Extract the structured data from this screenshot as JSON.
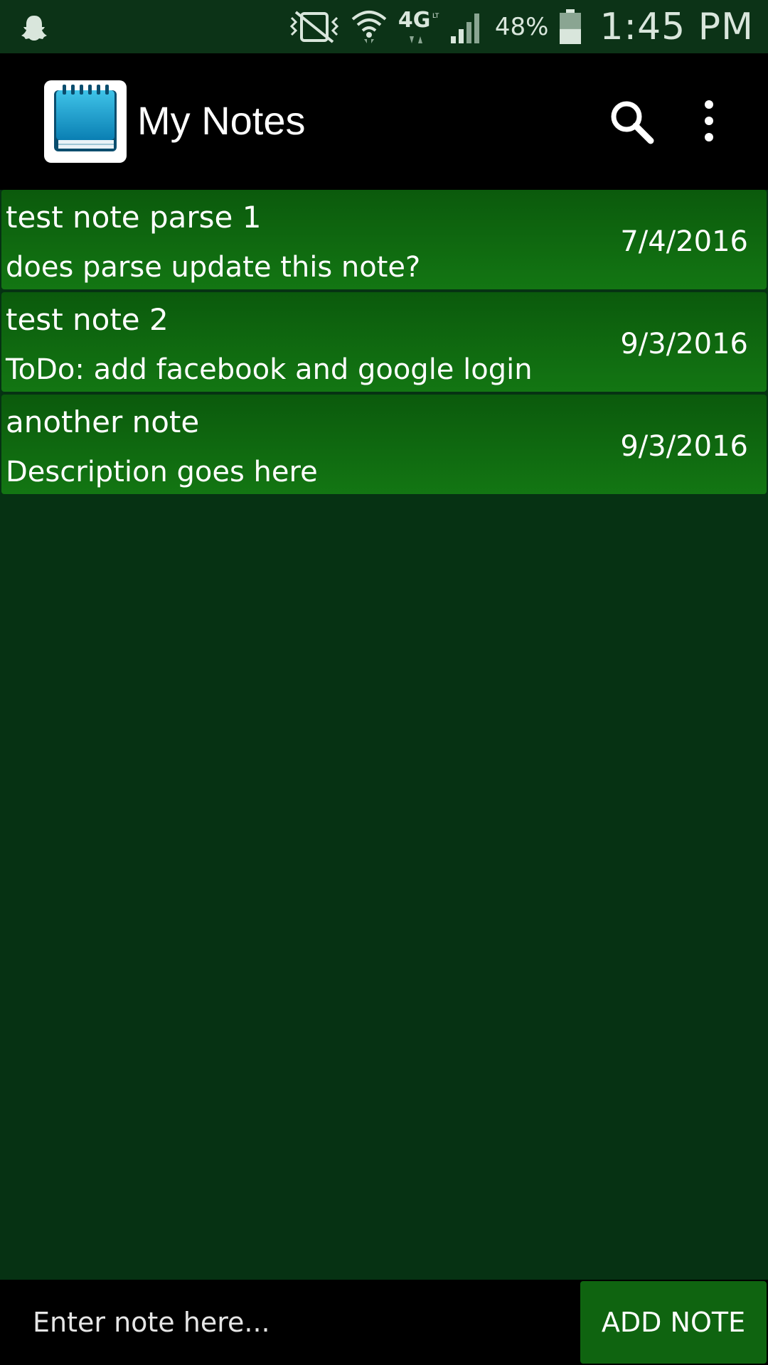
{
  "status_bar": {
    "icons": [
      "snapchat-ghost-icon",
      "vibrate-off-icon",
      "wifi-icon",
      "lte-4g-icon",
      "cell-signal-icon",
      "battery-icon"
    ],
    "network_label": "4G",
    "battery_percent": "48%",
    "battery_level": 0.48,
    "time": "1:45 PM"
  },
  "app_bar": {
    "title": "My Notes",
    "logo_icon": "notepad-icon",
    "actions": [
      "search-icon",
      "overflow-menu-icon"
    ]
  },
  "notes": [
    {
      "title": "test note parse 1",
      "description": "does parse update this note?",
      "date": "7/4/2016"
    },
    {
      "title": "test note 2",
      "description": "ToDo: add facebook and google login",
      "date": "9/3/2016"
    },
    {
      "title": "another note",
      "description": "Description goes here",
      "date": "9/3/2016"
    }
  ],
  "input_bar": {
    "placeholder": "Enter note here...",
    "value": "",
    "add_button_label": "ADD NOTE"
  },
  "colors": {
    "background": "#063213",
    "status_bar": "#0c3317",
    "app_bar": "#000000",
    "note_item": "#137613",
    "button": "#0f6410"
  }
}
